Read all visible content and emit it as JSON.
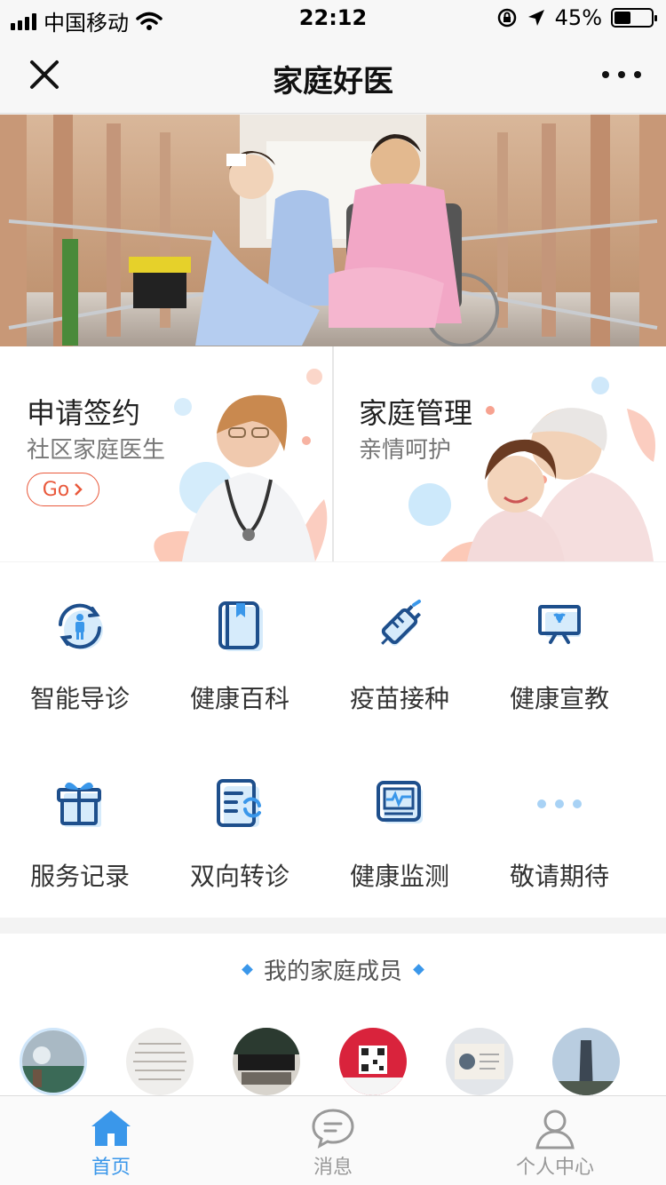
{
  "status_bar": {
    "carrier": "中国移动",
    "time": "22:12",
    "battery": "45%",
    "battery_level": 0.45
  },
  "nav": {
    "title": "家庭好医"
  },
  "promo": {
    "left": {
      "title": "申请签约",
      "subtitle": "社区家庭医生",
      "button": "Go"
    },
    "right": {
      "title": "家庭管理",
      "subtitle": "亲情呵护"
    }
  },
  "features": [
    {
      "label": "智能导诊",
      "icon": "person-refresh-icon"
    },
    {
      "label": "健康百科",
      "icon": "book-icon"
    },
    {
      "label": "疫苗接种",
      "icon": "syringe-icon"
    },
    {
      "label": "健康宣教",
      "icon": "presentation-board-icon"
    },
    {
      "label": "服务记录",
      "icon": "gift-icon"
    },
    {
      "label": "双向转诊",
      "icon": "document-refresh-icon"
    },
    {
      "label": "健康监测",
      "icon": "monitor-icon"
    },
    {
      "label": "敬请期待",
      "icon": "more-dots-icon"
    }
  ],
  "family": {
    "title": "我的家庭成员"
  },
  "tabbar": [
    {
      "label": "首页",
      "icon": "home-icon",
      "active": true
    },
    {
      "label": "消息",
      "icon": "chat-icon",
      "active": false
    },
    {
      "label": "个人中心",
      "icon": "person-icon",
      "active": false
    }
  ],
  "colors": {
    "accent": "#3a97ea",
    "go_button": "#e9593c"
  }
}
